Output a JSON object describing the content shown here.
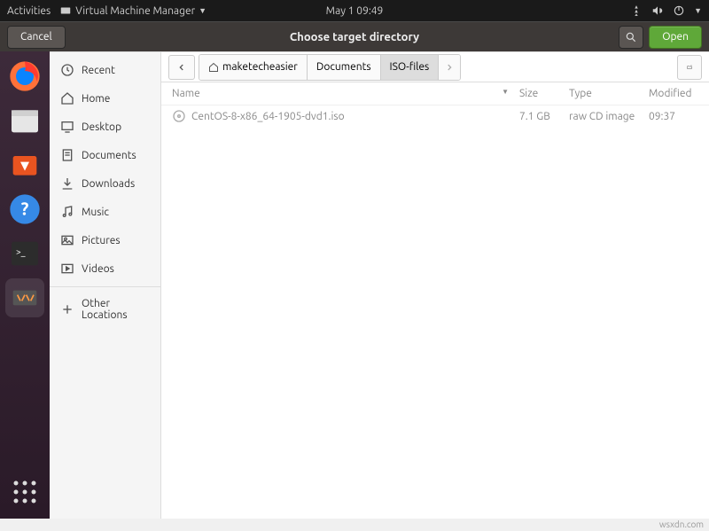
{
  "topbar": {
    "activities": "Activities",
    "app_menu": "Virtual Machine Manager",
    "clock": "May 1  09:49"
  },
  "dialog": {
    "title": "Choose target directory",
    "cancel": "Cancel",
    "open": "Open"
  },
  "places": {
    "recent": "Recent",
    "home": "Home",
    "desktop": "Desktop",
    "documents": "Documents",
    "downloads": "Downloads",
    "music": "Music",
    "pictures": "Pictures",
    "videos": "Videos",
    "other": "Other Locations"
  },
  "path": {
    "root": "maketecheasier",
    "seg1": "Documents",
    "seg2": "ISO-files"
  },
  "headers": {
    "name": "Name",
    "size": "Size",
    "type": "Type",
    "modified": "Modified"
  },
  "file": {
    "name": "CentOS-8-x86_64-1905-dvd1.iso",
    "size": "7.1 GB",
    "type": "raw CD image",
    "modified": "09:37"
  },
  "watermark": "wsxdn.com"
}
